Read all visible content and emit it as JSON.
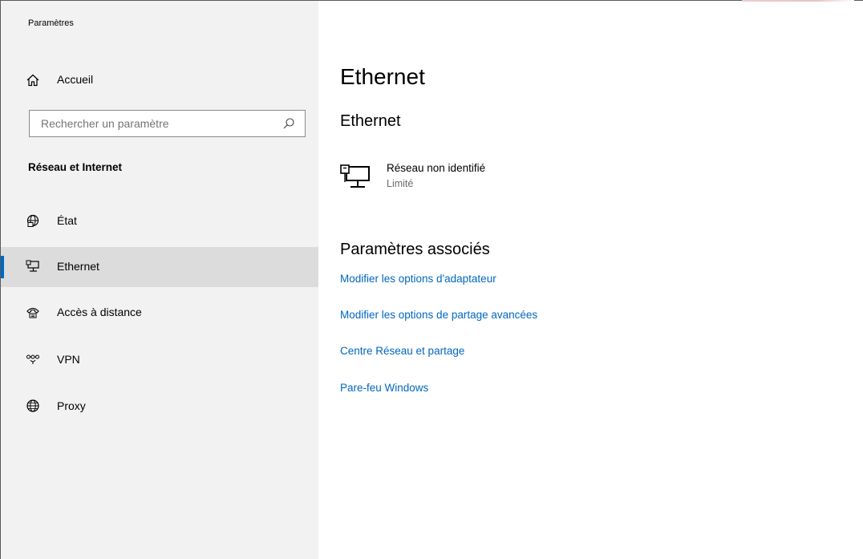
{
  "window": {
    "title": "Paramètres"
  },
  "sidebar": {
    "home_label": "Accueil",
    "search_placeholder": "Rechercher un paramètre",
    "section_title": "Réseau et Internet",
    "items": [
      {
        "label": "État",
        "icon": "globe-status-icon",
        "selected": false
      },
      {
        "label": "Ethernet",
        "icon": "ethernet-icon",
        "selected": true
      },
      {
        "label": "Accès à distance",
        "icon": "dialup-phone-icon",
        "selected": false
      },
      {
        "label": "VPN",
        "icon": "vpn-icon",
        "selected": false
      },
      {
        "label": "Proxy",
        "icon": "globe-icon",
        "selected": false
      }
    ]
  },
  "main": {
    "title": "Ethernet",
    "subtitle": "Ethernet",
    "network": {
      "name": "Réseau non identifié",
      "status": "Limité",
      "icon": "network-computer-icon"
    },
    "related_title": "Paramètres associés",
    "links": [
      "Modifier les options d'adaptateur",
      "Modifier les options de partage avancées",
      "Centre Réseau et partage",
      "Pare-feu Windows"
    ]
  },
  "colors": {
    "accent": "#0067c0",
    "sidebar_bg": "#f2f2f2",
    "selected_bg": "#dcdcdc"
  }
}
